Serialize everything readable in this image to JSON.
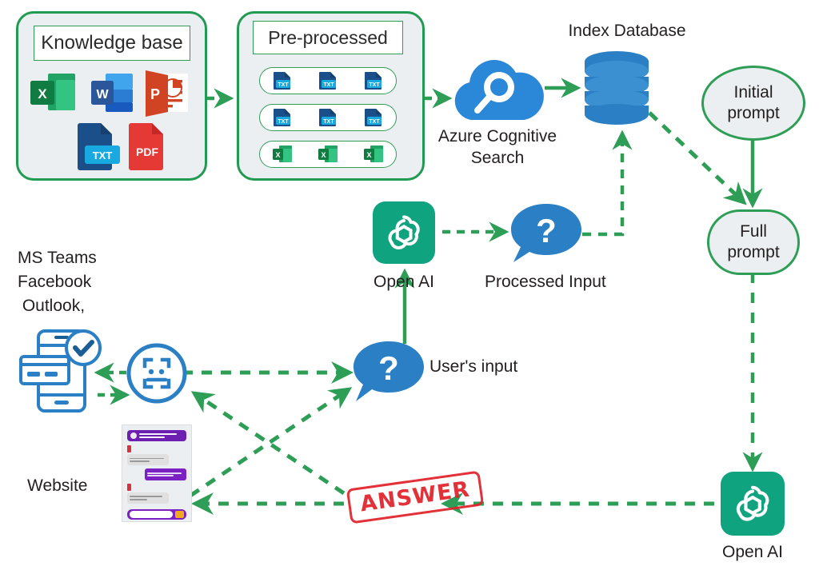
{
  "diagram": {
    "title": "Azure Cognitive Search with Open AI knowledge-base chatbot architecture",
    "colors": {
      "flow_green": "#2e9e57",
      "arrow_green": "#2e9e57",
      "panel_fill": "#eceff1",
      "azure_blue": "#2b88d8",
      "db_blue": "#2b7fc4",
      "openai_green": "#10a37f",
      "stamp_red": "#e1222b",
      "text": "#231f20",
      "excel_green": "#1d6f42",
      "word_blue": "#2b579a",
      "ppt_orange": "#d04423",
      "pdf_red": "#e53935",
      "txt_blue": "#17a9e0"
    },
    "panels": {
      "knowledge_base": {
        "title": "Knowledge base",
        "files": [
          {
            "name": "excel-file-icon",
            "label": "X"
          },
          {
            "name": "word-file-icon",
            "label": "W"
          },
          {
            "name": "powerpoint-file-icon",
            "label": "P"
          },
          {
            "name": "txt-file-icon",
            "label": "TXT"
          },
          {
            "name": "pdf-file-icon",
            "label": "PDF"
          }
        ]
      },
      "pre_processed": {
        "title": "Pre-processed",
        "rows": [
          {
            "type": "txt",
            "label": "TXT",
            "count": 3
          },
          {
            "type": "txt",
            "label": "TXT",
            "count": 3
          },
          {
            "type": "excel",
            "label": "X",
            "count": 3
          }
        ]
      }
    },
    "nodes": {
      "azure_search": {
        "label": "Azure Cognitive\nSearch",
        "icon": "cloud-search-icon"
      },
      "index_database": {
        "label": "Index Database",
        "icon": "database-cylinder-icon"
      },
      "initial_prompt": {
        "label_line1": "Initial",
        "label_line2": "prompt"
      },
      "full_prompt": {
        "label_line1": "Full",
        "label_line2": "prompt"
      },
      "open_ai_top": {
        "label": "Open AI",
        "icon": "openai-logo-icon"
      },
      "open_ai_bottom": {
        "label": "Open AI",
        "icon": "openai-logo-icon"
      },
      "processed_input": {
        "label": "Processed Input",
        "icon": "question-bubble-icon",
        "glyph": "?"
      },
      "users_input": {
        "label": "User's input",
        "icon": "question-bubble-icon",
        "glyph": "?"
      },
      "channels": {
        "label": "MS Teams\nFacebook\nOutlook,",
        "icon": "mobile-device-icon"
      },
      "chatbot": {
        "icon": "chatbot-circle-icon"
      },
      "website": {
        "label": "Website",
        "icon": "website-chat-mockup"
      },
      "answer": {
        "label": "ANSWER",
        "icon": "answer-stamp"
      }
    },
    "edges": [
      {
        "from": "knowledge_base",
        "to": "pre_processed",
        "style": "dashed"
      },
      {
        "from": "pre_processed",
        "to": "azure_search",
        "style": "dashed"
      },
      {
        "from": "azure_search",
        "to": "index_database",
        "style": "solid"
      },
      {
        "from": "processed_input",
        "to": "index_database",
        "style": "dashed"
      },
      {
        "from": "index_database",
        "to": "full_prompt",
        "style": "dashed"
      },
      {
        "from": "initial_prompt",
        "to": "full_prompt",
        "style": "solid"
      },
      {
        "from": "full_prompt",
        "to": "open_ai_bottom",
        "style": "dashed"
      },
      {
        "from": "open_ai_top",
        "to": "processed_input",
        "style": "dashed"
      },
      {
        "from": "users_input",
        "to": "open_ai_top",
        "style": "solid"
      },
      {
        "from": "chatbot",
        "to": "users_input",
        "style": "dashed"
      },
      {
        "from": "chatbot",
        "to": "channels",
        "style": "dashed"
      },
      {
        "from": "channels",
        "to": "chatbot",
        "style": "dashed"
      },
      {
        "from": "website",
        "to": "users_input",
        "style": "dashed"
      },
      {
        "from": "answer",
        "to": "chatbot",
        "style": "dashed"
      },
      {
        "from": "answer",
        "to": "website",
        "style": "dashed"
      },
      {
        "from": "open_ai_bottom",
        "to": "answer",
        "style": "dashed"
      }
    ]
  }
}
